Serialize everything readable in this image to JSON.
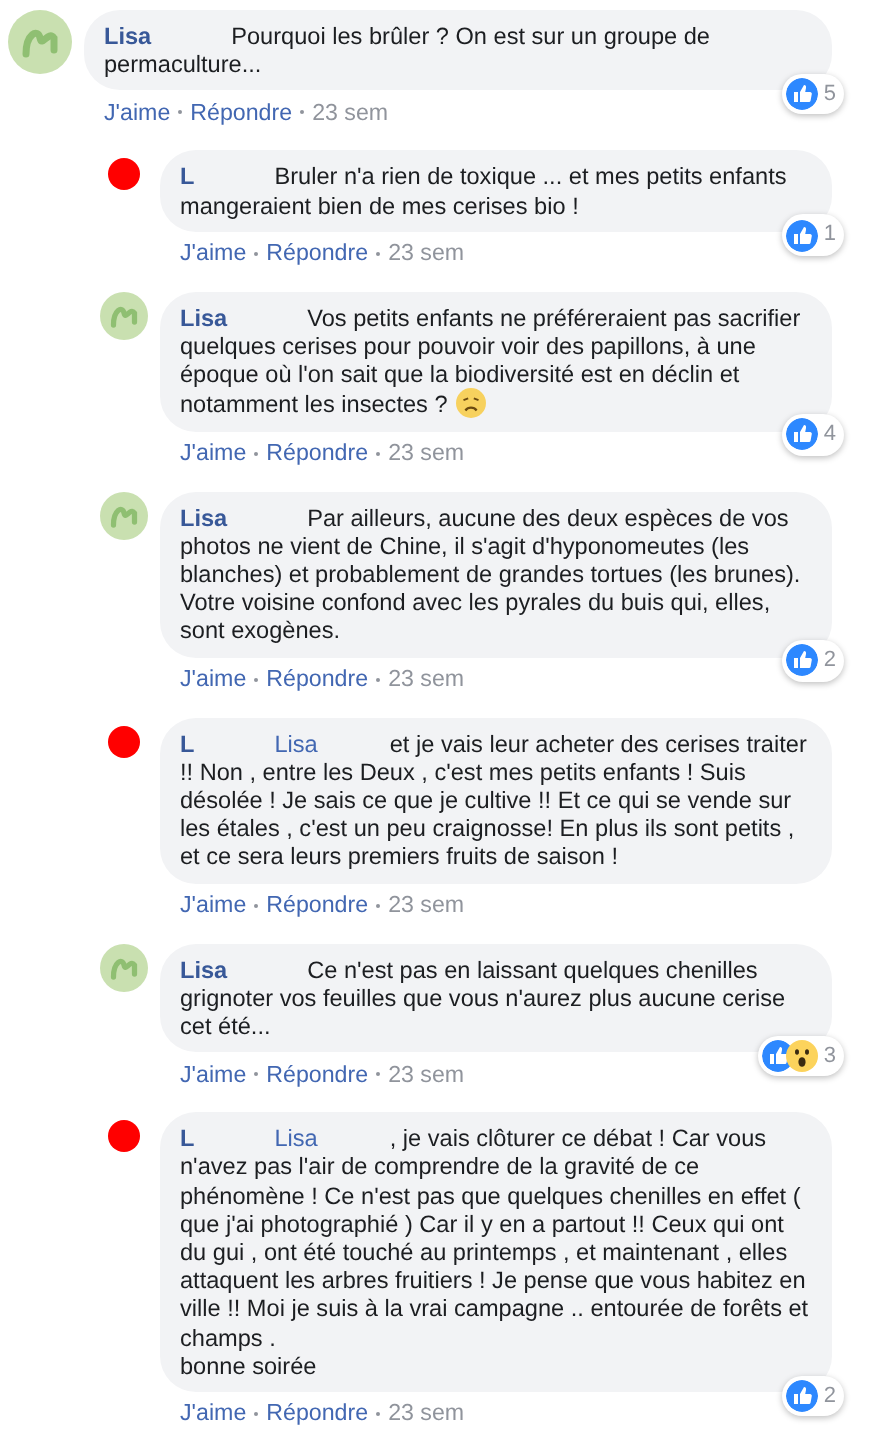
{
  "comments": [
    {
      "author": "Lisa",
      "avatar": {
        "kind": "worm"
      },
      "text": "Pourquoi les brûler ? On est sur un groupe de permaculture...",
      "reactions": [
        {
          "kind": "like"
        }
      ],
      "count": "5",
      "actions": [
        "J'aime",
        "Répondre",
        "23 sem"
      ],
      "children": [
        {
          "author": "L",
          "avatar": {
            "kind": "red"
          },
          "text": "Bruler n'a rien de toxique ... et mes petits enfants mangeraient bien de mes cerises bio !",
          "reactions": [
            {
              "kind": "like"
            }
          ],
          "count": "1",
          "actions": [
            "J'aime",
            "Répondre",
            "23 sem"
          ]
        },
        {
          "author": "Lisa",
          "avatar": {
            "kind": "worm"
          },
          "text": "Vos petits enfants ne préféreraient pas sacrifier quelques cerises pour pouvoir voir des papillons, à une époque où l'on sait que la biodiversité est en déclin et notamment les insectes ?",
          "emoji": {
            "kind": "worried"
          },
          "reactions": [
            {
              "kind": "like"
            }
          ],
          "count": "4",
          "actions": [
            "J'aime",
            "Répondre",
            "23 sem"
          ]
        },
        {
          "author": "Lisa",
          "avatar": {
            "kind": "worm"
          },
          "text": "Par ailleurs, aucune des deux espèces de vos photos ne vient de Chine, il s'agit d'hyponomeutes (les blanches) et probablement de grandes tortues (les brunes). Votre voisine confond avec les pyrales du buis qui, elles, sont exogènes.",
          "reactions": [
            {
              "kind": "like"
            }
          ],
          "count": "2",
          "actions": [
            "J'aime",
            "Répondre",
            "23 sem"
          ]
        },
        {
          "author": "L",
          "mention": "Lisa",
          "avatar": {
            "kind": "red"
          },
          "text": "et je vais leur acheter des cerises traiter !! Non , entre les Deux , c'est mes petits enfants ! Suis désolée ! Je sais ce que je cultive !! Et ce qui se vende sur les étales , c'est un peu craignosse! En plus ils sont petits , et ce sera leurs premiers fruits de saison !",
          "actions": [
            "J'aime",
            "Répondre",
            "23 sem"
          ]
        },
        {
          "author": "Lisa",
          "avatar": {
            "kind": "worm"
          },
          "text": "Ce n'est pas en laissant quelques chenilles grignoter vos feuilles que vous n'aurez plus aucune cerise cet été...",
          "reactions": [
            {
              "kind": "like"
            },
            {
              "kind": "wow"
            }
          ],
          "count": "3",
          "actions": [
            "J'aime",
            "Répondre",
            "23 sem"
          ]
        },
        {
          "author": "L",
          "mention": "Lisa",
          "avatar": {
            "kind": "red"
          },
          "text": ", je vais clôturer ce débat ! Car vous n'avez pas l'air de comprendre de la gravité de ce phénomène ! Ce n'est pas que quelques chenilles en effet ( que j'ai photographié ) Car il y en a partout !! Ceux qui ont du gui , ont été touché au printemps , et maintenant , elles attaquent les arbres fruitiers ! Je pense que vous habitez en ville !! Moi je suis à la vrai campagne .. entourée de forêts et champs .\nbonne soirée",
          "reactions": [
            {
              "kind": "like"
            }
          ],
          "count": "2",
          "actions": [
            "J'aime",
            "Répondre",
            "23 sem"
          ]
        }
      ]
    }
  ]
}
